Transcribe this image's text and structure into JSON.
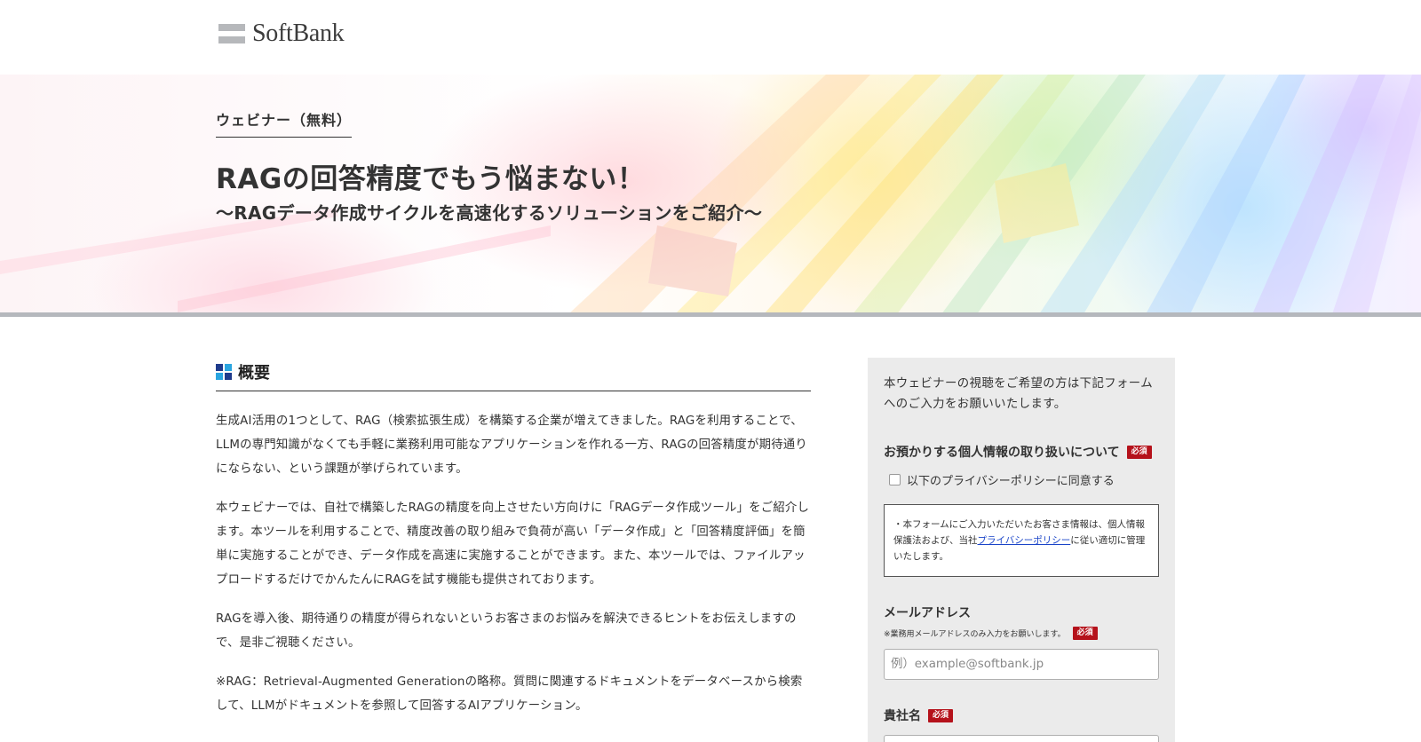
{
  "header": {
    "logo_text": "SoftBank"
  },
  "hero": {
    "eyebrow": "ウェビナー（無料）",
    "title": "RAGの回答精度でもう悩まない！",
    "subtitle": "〜RAGデータ作成サイクルを高速化するソリューションをご紹介〜"
  },
  "overview": {
    "title": "概要",
    "icon_colors": [
      "#1f3b8c",
      "#2aa5e0",
      "#2aa5e0",
      "#1f3b8c"
    ],
    "paragraphs": [
      "生成AI活用の1つとして、RAG（検索拡張生成）を構築する企業が増えてきました。RAGを利用することで、LLMの専門知識がなくても手軽に業務利用可能なアプリケーションを作れる一方、RAGの回答精度が期待通りにならない、という課題が挙げられています。",
      "本ウェビナーでは、自社で構築したRAGの精度を向上させたい方向けに「RAGデータ作成ツール」をご紹介します。本ツールを利用することで、精度改善の取り組みで負荷が高い「データ作成」と「回答精度評価」を簡単に実施することができ、データ作成を高速に実施することができます。また、本ツールでは、ファイルアップロードするだけでかんたんにRAGを試す機能も提供されております。",
      "RAGを導入後、期待通りの精度が得られないというお客さまのお悩みを解決できるヒントをお伝えしますので、是非ご視聴ください。",
      "※RAG：Retrieval-Augmented Generationの略称。質問に関連するドキュメントをデータベースから検索して、LLMがドキュメントを参照して回答するAIアプリケーション。"
    ]
  },
  "form": {
    "intro": "本ウェビナーの視聴をご希望の方は下記フォームへのご入力をお願いいたします。",
    "required_badge": "必須",
    "privacy": {
      "label": "お預かりする個人情報の取り扱いについて",
      "checkbox_label": "以下のプライバシーポリシーに同意する",
      "notice_before": "・本フォームにご入力いただいたお客さま情報は、個人情報保護法および、当社",
      "notice_link": "プライバシーポリシー",
      "notice_after": "に従い適切に管理いたします。"
    },
    "email": {
      "label": "メールアドレス",
      "note": "※業務用メールアドレスのみ入力をお願いします。",
      "placeholder": "例）example@softbank.jp"
    },
    "company": {
      "label": "貴社名"
    }
  },
  "colors": {
    "required_badge": "#b5121b",
    "link": "#1a44c8",
    "form_panel_bg": "#ebebeb",
    "hero_bottom_bar": "#b5b8bd"
  }
}
